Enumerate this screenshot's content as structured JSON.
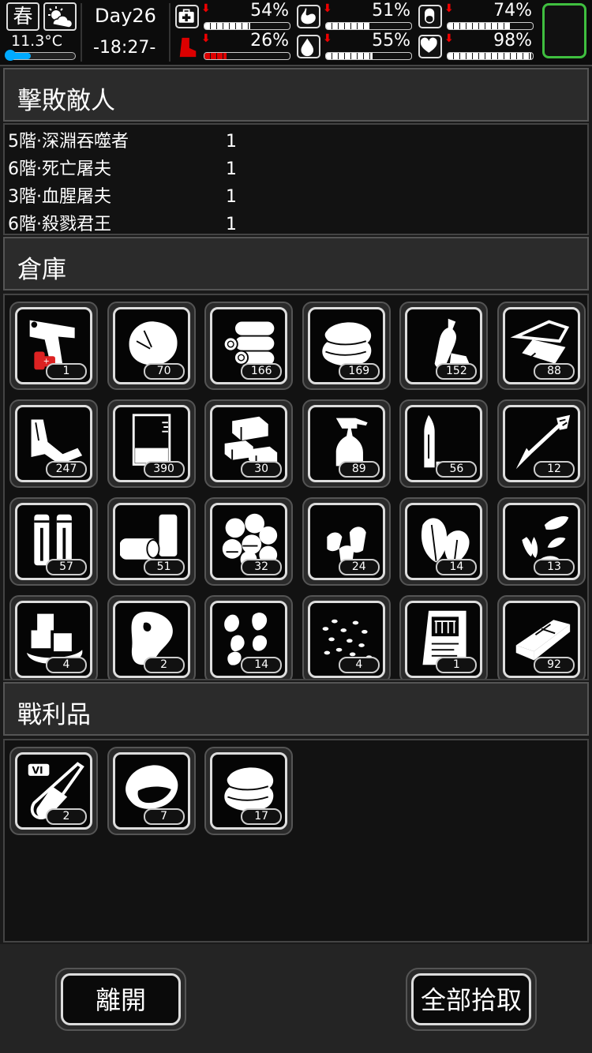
{
  "status": {
    "season": "春",
    "temperature": "11.3°C",
    "temperature_level": 0.35,
    "day": "Day26",
    "time": "-18:27-",
    "stats": [
      {
        "icon": "medkit-icon",
        "value": "54%",
        "level": 0.54,
        "critical": false
      },
      {
        "icon": "stomach-icon",
        "value": "51%",
        "level": 0.51,
        "critical": false
      },
      {
        "icon": "pill-icon",
        "value": "74%",
        "level": 0.74,
        "critical": false
      },
      {
        "icon": "boot-icon",
        "value": "26%",
        "level": 0.26,
        "critical": true
      },
      {
        "icon": "water-drop-icon",
        "value": "55%",
        "level": 0.55,
        "critical": false
      },
      {
        "icon": "heart-icon",
        "value": "98%",
        "level": 0.98,
        "critical": false
      }
    ],
    "trend_arrow": "⬇"
  },
  "defeated": {
    "title": "擊敗敵人",
    "rows": [
      {
        "name": "5階·深淵吞噬者",
        "count": "1"
      },
      {
        "name": "6階·死亡屠夫",
        "count": "1"
      },
      {
        "name": "3階·血腥屠夫",
        "count": "1"
      },
      {
        "name": "6階·殺戮君王",
        "count": "1"
      }
    ]
  },
  "storage": {
    "title": "倉庫",
    "items": [
      {
        "icon": "flare-gun-icon",
        "count": "1"
      },
      {
        "icon": "fur-pelt-icon",
        "count": "70"
      },
      {
        "icon": "logs-icon",
        "count": "166"
      },
      {
        "icon": "cloth-icon",
        "count": "169"
      },
      {
        "icon": "plastic-bottle-icon",
        "count": "152"
      },
      {
        "icon": "metal-sheet-icon",
        "count": "88"
      },
      {
        "icon": "rags-icon",
        "count": "247"
      },
      {
        "icon": "beaker-icon",
        "count": "390"
      },
      {
        "icon": "bricks-icon",
        "count": "30"
      },
      {
        "icon": "spray-bottle-icon",
        "count": "89"
      },
      {
        "icon": "bullet-icon",
        "count": "56"
      },
      {
        "icon": "arrow-icon",
        "count": "12"
      },
      {
        "icon": "shotgun-shells-icon",
        "count": "57"
      },
      {
        "icon": "cans-icon",
        "count": "51"
      },
      {
        "icon": "cotton-balls-icon",
        "count": "32"
      },
      {
        "icon": "seeds-icon",
        "count": "24"
      },
      {
        "icon": "leaves-icon",
        "count": "14"
      },
      {
        "icon": "sunflower-seeds-icon",
        "count": "13"
      },
      {
        "icon": "ice-cubes-icon",
        "count": "4"
      },
      {
        "icon": "raw-meat-icon",
        "count": "2"
      },
      {
        "icon": "nuts-icon",
        "count": "14"
      },
      {
        "icon": "rice-grains-icon",
        "count": "4"
      },
      {
        "icon": "seed-packet-icon",
        "count": "1"
      },
      {
        "icon": "chocolate-bar-icon",
        "count": "92"
      }
    ]
  },
  "loot": {
    "title": "戰利品",
    "items": [
      {
        "icon": "test-tube-icon",
        "count": "2",
        "tier": "VI"
      },
      {
        "icon": "ore-chunk-icon",
        "count": "7"
      },
      {
        "icon": "cloth-icon",
        "count": "17"
      }
    ]
  },
  "buttons": {
    "leave": "離開",
    "take_all": "全部拾取"
  },
  "colors": {
    "equip_slot_border": "#3fbf3f",
    "critical": "#dd0000",
    "temperature": "#00aaff"
  }
}
